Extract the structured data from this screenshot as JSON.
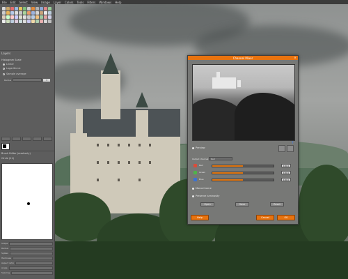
{
  "menubar": {
    "items": [
      "File",
      "Edit",
      "Select",
      "View",
      "Image",
      "Layer",
      "Colors",
      "Tools",
      "Filters",
      "Windows",
      "Help"
    ]
  },
  "dock": {
    "layers_title": "Layers",
    "mode_title": "Histogram Scale",
    "options": [
      {
        "label": "Linear",
        "selected": true
      },
      {
        "label": "Logarithmic",
        "selected": false
      }
    ],
    "sample_label": "Sample average",
    "radius_label": "Radius",
    "radius_value": "3",
    "brush_title": "Brush Editor (read only)",
    "brush_name": "Circle (11)",
    "brush_props": [
      "Shape",
      "Radius",
      "Spikes",
      "Hardness",
      "Aspect ratio",
      "Angle",
      "Spacing"
    ]
  },
  "dialog": {
    "title": "Channel Mixer",
    "preview_label": "Preview",
    "output_label": "Output channel:",
    "output_value": "Red",
    "channels": [
      {
        "name": "Red",
        "value": "100.0",
        "color": "#d94c3a",
        "fill": 0.5
      },
      {
        "name": "Green",
        "value": "100.0",
        "color": "#4fb34a",
        "fill": 0.5
      },
      {
        "name": "Blue",
        "value": "100.0",
        "color": "#3c72d2",
        "fill": 0.5
      }
    ],
    "monochrome_label": "Monochrome",
    "preserve_label": "Preserve luminosity",
    "btn_open": "Open",
    "btn_save": "Save",
    "btn_reset": "Reset",
    "btn_help": "Help",
    "btn_cancel": "Cancel",
    "btn_ok": "OK"
  },
  "colors": {
    "accent": "#e8730f",
    "dock_bg": "#5d5d5d"
  }
}
